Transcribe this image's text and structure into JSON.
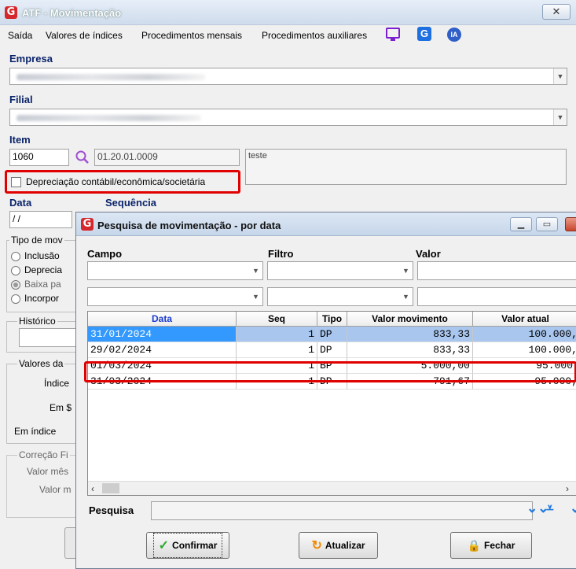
{
  "window": {
    "title": "ATF - Movimentação",
    "close": "✕"
  },
  "menu": [
    "Saída",
    "Valores de índices",
    "Procedimentos mensais",
    "Procedimentos auxiliares"
  ],
  "menu_icons": {
    "chat": "monitor-chat-icon",
    "logo": "g-logo-icon",
    "ia": "IA"
  },
  "form": {
    "empresa_label": "Empresa",
    "filial_label": "Filial",
    "item_label": "Item",
    "item_code": "1060",
    "item_account": "01.20.01.0009",
    "item_desc": "teste",
    "depreciacao_label": "Depreciação contábil/econômica/societária",
    "data_label": "Data",
    "data_value": "/ /",
    "sequencia_label": "Sequência",
    "tipo_group": "Tipo de mov",
    "tipo_options": [
      "Inclusão",
      "Deprecia",
      "Baixa pa",
      "Incorpor"
    ],
    "historico_label": "Histórico",
    "valores_group": "Valores da",
    "indice_label": "Índice",
    "em_label": "Em $",
    "em_indice_label": "Em índice",
    "correcao_group": "Correção Fi",
    "valor_mes_label": "Valor mês",
    "valor_m_label": "Valor m"
  },
  "dialog": {
    "title": "Pesquisa de movimentação - por data",
    "filter_headers": {
      "campo": "Campo",
      "filtro": "Filtro",
      "valor": "Valor"
    },
    "columns": [
      "Data",
      "Seq",
      "Tipo",
      "Valor movimento",
      "Valor atual"
    ],
    "rows": [
      {
        "data": "31/01/2024",
        "seq": "1",
        "tipo": "DP",
        "valor_mov": "833,33",
        "valor_atual": "100.000,"
      },
      {
        "data": "29/02/2024",
        "seq": "1",
        "tipo": "DP",
        "valor_mov": "833,33",
        "valor_atual": "100.000,"
      },
      {
        "data": "01/03/2024",
        "seq": "1",
        "tipo": "BP",
        "valor_mov": "5.000,00",
        "valor_atual": "95.000"
      },
      {
        "data": "31/03/2024",
        "seq": "1",
        "tipo": "DP",
        "valor_mov": "791,67",
        "valor_atual": "95.000,"
      }
    ],
    "pesquisa_label": "Pesquisa",
    "buttons": {
      "confirmar": "Confirmar",
      "atualizar": "Atualizar",
      "fechar": "Fechar"
    }
  },
  "colors": {
    "accent": "#d4282c",
    "highlight": "#e00000",
    "selected_row": "#3399ff"
  }
}
